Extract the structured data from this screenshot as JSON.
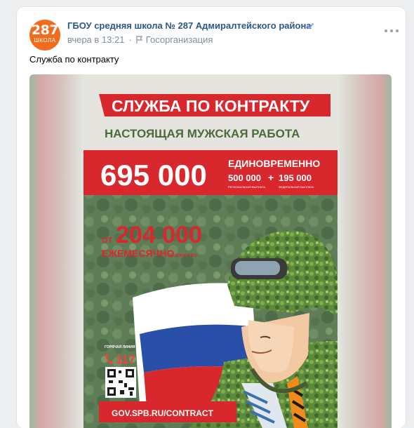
{
  "post": {
    "author": "ГБОУ средняя школа № 287 Адмиралтейского района",
    "time": "вчера в 13:21",
    "category": "Госорганизация",
    "text": "Служба по контракту",
    "avatar": {
      "num": "287",
      "word": "ШКОЛА"
    }
  },
  "poster": {
    "title": "СЛУЖБА ПО КОНТРАКТУ",
    "subtitle": "НАСТОЯЩАЯ МУЖСКАЯ РАБОТА",
    "lump_sum": "695 000",
    "lump_sum_label": "ЕДИНОВРЕМЕННО",
    "regional_amount": "500 000",
    "regional_label": "РЕГИОНАЛЬНАЯ ВЫПЛАТА",
    "plus": "+",
    "federal_amount": "195 000",
    "federal_label": "ФЕДЕРАЛЬНАЯ ВЫПЛАТА",
    "from": "ОТ",
    "monthly_amount": "204 000",
    "monthly_label": "ЕЖЕМЕСЯЧНО",
    "zone_label": "В ЗОНЕ СВО",
    "hotline_label": "ГОРЯЧАЯ ЛИНИЯ",
    "hotline_number": "117",
    "url": "GOV.SPB.RU/CONTRACT"
  },
  "colors": {
    "link": "#2a5885",
    "meta": "#818c99",
    "avatar": "#f26a1b",
    "poster_red": "#d9272e",
    "poster_green": "#5b7a55"
  },
  "icons": [
    "verified-icon",
    "flag-icon",
    "more-icon",
    "phone-icon",
    "qr-code-icon"
  ]
}
